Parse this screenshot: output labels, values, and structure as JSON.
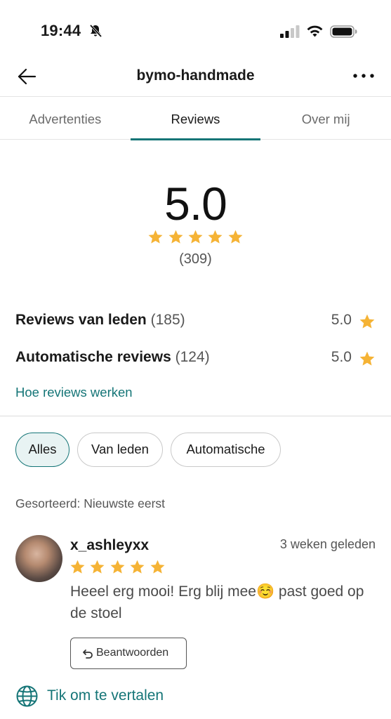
{
  "status_bar": {
    "time": "19:44",
    "icons": [
      "bell-slash-icon",
      "cellular-signal-icon",
      "wifi-icon",
      "battery-icon"
    ]
  },
  "header": {
    "title": "bymo-handmade",
    "back_icon": "arrow-left-icon",
    "more_icon": "more-dots-icon"
  },
  "tabs": [
    {
      "label": "Advertenties",
      "active": false
    },
    {
      "label": "Reviews",
      "active": true
    },
    {
      "label": "Over mij",
      "active": false
    }
  ],
  "rating": {
    "average": "5.0",
    "stars": 5,
    "count": "(309)"
  },
  "summary": {
    "members": {
      "label": "Reviews van leden",
      "count": "(185)",
      "value": "5.0"
    },
    "automatic": {
      "label": "Automatische reviews",
      "count": "(124)",
      "value": "5.0"
    }
  },
  "how_reviews_link": "Hoe reviews werken",
  "filters": [
    {
      "label": "Alles",
      "active": true
    },
    {
      "label": "Van leden",
      "active": false
    },
    {
      "label": "Automatische",
      "active": false
    }
  ],
  "sort_text": "Gesorteerd: Nieuwste eerst",
  "review": {
    "username": "x_ashleyxx",
    "date": "3 weken geleden",
    "stars": 5,
    "text": "Heeel erg mooi! Erg blij mee☺️ past goed op de stoel",
    "reply_label": "Beantwoorden",
    "translate_label": "Tik om te vertalen"
  },
  "colors": {
    "accent": "#157577",
    "star": "#f5b335",
    "chip_active_bg": "#e8f3f3"
  }
}
